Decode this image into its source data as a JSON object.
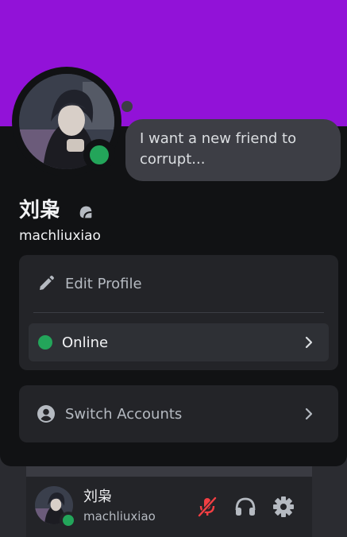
{
  "profile": {
    "status_text": "I want a new friend to corrupt...",
    "display_name": "刘枭",
    "username": "machliuxiao"
  },
  "menu": {
    "edit_profile_label": "Edit Profile",
    "status_label": "Online",
    "switch_accounts_label": "Switch Accounts"
  },
  "user_panel": {
    "display_name": "刘枭",
    "username": "machliuxiao"
  },
  "colors": {
    "banner": "#9212d8",
    "online": "#23a55a",
    "muted": "#f23f43"
  },
  "icons": [
    "nitro-badge-icon",
    "pencil-icon",
    "chevron-right-icon",
    "user-circle-icon",
    "mic-muted-icon",
    "headphones-icon",
    "gear-icon"
  ]
}
